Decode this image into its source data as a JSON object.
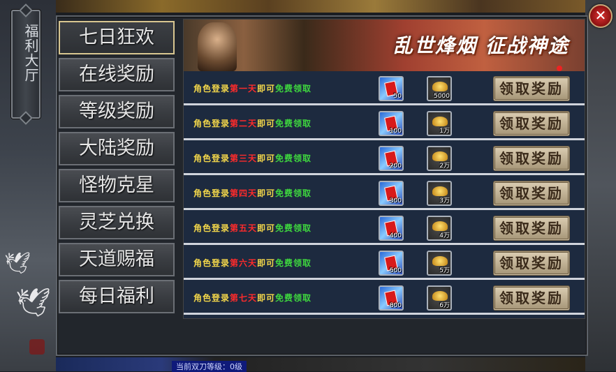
{
  "title": "福利大厅",
  "close_icon": "close-icon",
  "menu": [
    {
      "label": "七日狂欢",
      "active": true
    },
    {
      "label": "在线奖励"
    },
    {
      "label": "等级奖励"
    },
    {
      "label": "大陆奖励"
    },
    {
      "label": "怪物克星"
    },
    {
      "label": "灵芝兑换"
    },
    {
      "label": "天道赐福"
    },
    {
      "label": "每日福利"
    }
  ],
  "banner": {
    "slogan": "乱世烽烟 征战神途"
  },
  "rows": [
    {
      "prefix": "角色登录",
      "day": "第一天",
      "mid": "即可",
      "suffix": "免费领取",
      "ticket_qty": "50",
      "gold_qty": "5000",
      "button": "领取奖励"
    },
    {
      "prefix": "角色登录",
      "day": "第二天",
      "mid": "即可",
      "suffix": "免费领取",
      "ticket_qty": "100",
      "gold_qty": "1万",
      "button": "领取奖励"
    },
    {
      "prefix": "角色登录",
      "day": "第三天",
      "mid": "即可",
      "suffix": "免费领取",
      "ticket_qty": "200",
      "gold_qty": "2万",
      "button": "领取奖励"
    },
    {
      "prefix": "角色登录",
      "day": "第四天",
      "mid": "即可",
      "suffix": "免费领取",
      "ticket_qty": "300",
      "gold_qty": "3万",
      "button": "领取奖励"
    },
    {
      "prefix": "角色登录",
      "day": "第五天",
      "mid": "即可",
      "suffix": "免费领取",
      "ticket_qty": "400",
      "gold_qty": "4万",
      "button": "领取奖励"
    },
    {
      "prefix": "角色登录",
      "day": "第六天",
      "mid": "即可",
      "suffix": "免费领取",
      "ticket_qty": "500",
      "gold_qty": "5万",
      "button": "领取奖励"
    },
    {
      "prefix": "角色登录",
      "day": "第七天",
      "mid": "即可",
      "suffix": "免费领取",
      "ticket_qty": "800",
      "gold_qty": "6万",
      "button": "领取奖励"
    }
  ],
  "bottom_bar": {
    "text": "当前双刀等级：0级"
  },
  "colors": {
    "highlight": "#f2d64a",
    "day": "#ff2b2b",
    "free": "#3ed63e"
  }
}
